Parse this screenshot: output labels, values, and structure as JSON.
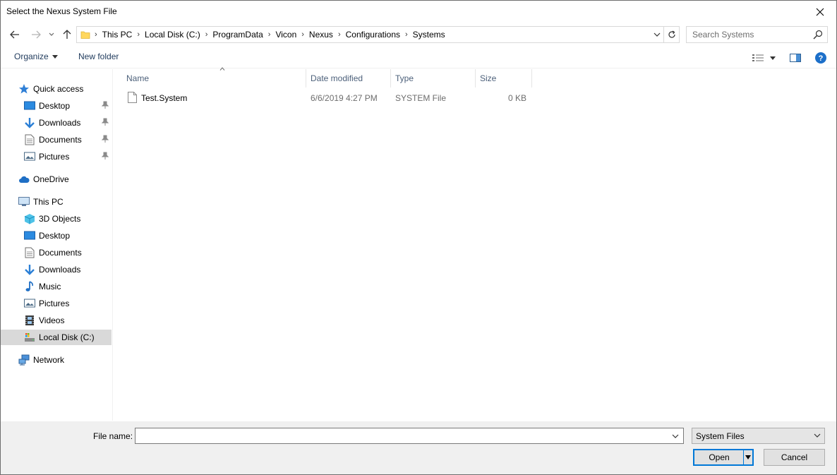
{
  "window": {
    "title": "Select the Nexus System File"
  },
  "address": {
    "breadcrumbs": [
      "This PC",
      "Local Disk (C:)",
      "ProgramData",
      "Vicon",
      "Nexus",
      "Configurations",
      "Systems"
    ]
  },
  "search": {
    "placeholder": "Search Systems"
  },
  "toolbar": {
    "organize_label": "Organize",
    "new_folder_label": "New folder"
  },
  "nav": {
    "quick_access": "Quick access",
    "qa_desktop": "Desktop",
    "qa_downloads": "Downloads",
    "qa_documents": "Documents",
    "qa_pictures": "Pictures",
    "onedrive": "OneDrive",
    "this_pc": "This PC",
    "pc_3d_objects": "3D Objects",
    "pc_desktop": "Desktop",
    "pc_documents": "Documents",
    "pc_downloads": "Downloads",
    "pc_music": "Music",
    "pc_pictures": "Pictures",
    "pc_videos": "Videos",
    "pc_local_disk": "Local Disk (C:)",
    "network": "Network"
  },
  "columns": {
    "name": "Name",
    "date_modified": "Date modified",
    "type": "Type",
    "size": "Size"
  },
  "files": [
    {
      "name": "Test.System",
      "date_modified": "6/6/2019 4:27 PM",
      "type": "SYSTEM File",
      "size": "0 KB"
    }
  ],
  "footer": {
    "file_name_label": "File name:",
    "file_name_value": "",
    "file_type": "System Files",
    "open_label": "Open",
    "cancel_label": "Cancel"
  },
  "colors": {
    "accent": "#0078d7",
    "selected_bg": "#d9d9d9",
    "header_text": "#4c607a",
    "secondary_text": "#6d6d6d"
  }
}
